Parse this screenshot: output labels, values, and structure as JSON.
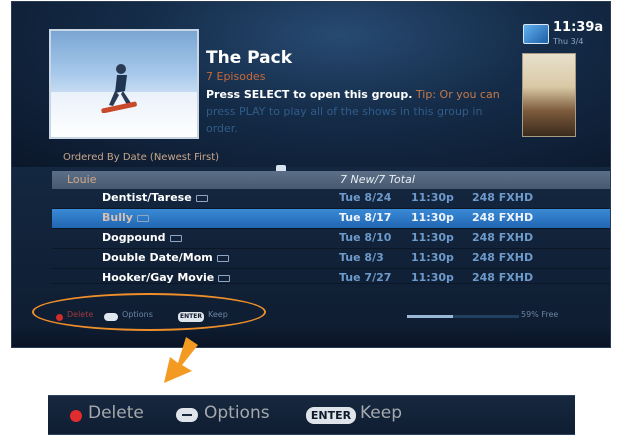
{
  "header": {
    "title": "The Pack",
    "episodes": "7 Episodes",
    "instruction_bold": "Press SELECT to open this group.",
    "instruction_tip": " Tip: Or you can",
    "instruction_rest": "press PLAY to play all of the shows in this group in order."
  },
  "clock": {
    "time": "11:39a",
    "date": "Thu 3/4"
  },
  "list": {
    "order_label": "Ordered By Date (Newest First)",
    "group": {
      "name": "Louie",
      "total": "7 New/7 Total"
    },
    "rows": [
      {
        "name": "Dentist/Tarese",
        "date": "Tue 8/24",
        "time": "11:30p",
        "channel": "248 FXHD",
        "selected": false
      },
      {
        "name": "Bully",
        "date": "Tue 8/17",
        "time": "11:30p",
        "channel": "248 FXHD",
        "selected": true
      },
      {
        "name": "Dogpound",
        "date": "Tue 8/10",
        "time": "11:30p",
        "channel": "248 FXHD",
        "selected": false
      },
      {
        "name": "Double Date/Mom",
        "date": "Tue 8/3",
        "time": "11:30p",
        "channel": "248 FXHD",
        "selected": false
      },
      {
        "name": "Hooker/Gay Movie",
        "date": "Tue 7/27",
        "time": "11:30p",
        "channel": "248 FXHD",
        "selected": false
      }
    ]
  },
  "footer": {
    "delete_label": "Delete",
    "options_label": "Options",
    "enter_badge": "ENTER",
    "keep_label": "Keep",
    "free_label": "59% Free",
    "free_percent": 59
  },
  "zoom": {
    "delete_label": "Delete",
    "options_label": "Options",
    "enter_badge": "ENTER",
    "keep_label": "Keep"
  },
  "colors": {
    "highlight_oval": "#ef8f2a",
    "selection": "#2a76c6",
    "delete_dot": "#e12d2d"
  },
  "icons": [
    "recording-icon",
    "tv-clock-icon",
    "down-arrow-icon"
  ]
}
